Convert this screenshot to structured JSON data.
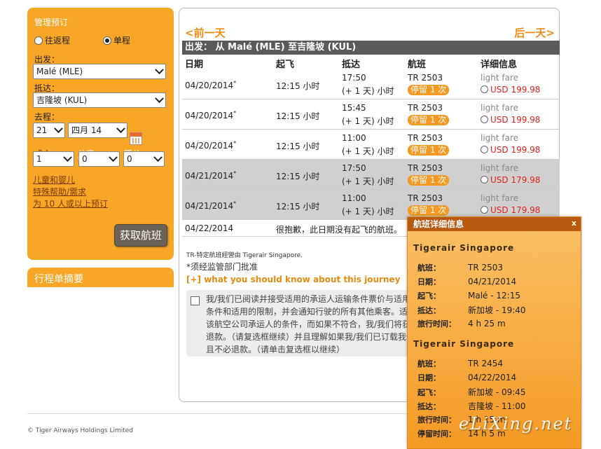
{
  "booking": {
    "title": "管理预订",
    "round_trip_label": "往返程",
    "one_way_label": "单程",
    "origin_label": "出发：",
    "origin_value": "Malé (MLE)",
    "destination_label": "抵达：",
    "destination_value": "吉隆坡 (KUL)",
    "depart_label": "去程：",
    "day_value": "21",
    "month_value": "四月 14",
    "adults_label": "成人",
    "children_label": "儿童",
    "infants_label": "婴儿",
    "adults_value": "1",
    "children_value": "0",
    "infants_value": "0",
    "links": [
      "儿童和婴儿",
      "特殊帮助/需求",
      "为 10 人或以上预订"
    ],
    "search_button": "获取航班"
  },
  "itinerary": {
    "title": "行程单摘要"
  },
  "results": {
    "prev_day": "<前一天",
    "next_day": "后一天>",
    "route": "出发： 从     Malé (MLE) 至吉隆坡 (KUL)",
    "headers": {
      "date": "日期",
      "depart": "起飞",
      "arrive": "抵达",
      "flight": "航班",
      "details": "详细信息"
    },
    "rows": [
      {
        "date": "04/20/2014",
        "mark": "*",
        "depart": "12:15 小时",
        "arrive": "17:50",
        "arrive2": "(+ 1 天) 小时",
        "flight": "TR 2503",
        "stops": "停留 1 次",
        "fare": "light fare",
        "price": "USD 199.98"
      },
      {
        "date": "04/20/2014",
        "mark": "*",
        "depart": "12:15 小时",
        "arrive": "15:45",
        "arrive2": "(+ 1 天) 小时",
        "flight": "TR 2503",
        "stops": "停留 1 次",
        "fare": "light fare",
        "price": "USD 199.98"
      },
      {
        "date": "04/20/2014",
        "mark": "*",
        "depart": "12:15 小时",
        "arrive": "11:00",
        "arrive2": "(+ 1 天) 小时",
        "flight": "TR 2503",
        "stops": "停留 1 次",
        "fare": "light fare",
        "price": "USD 199.98"
      },
      {
        "date": "04/21/2014",
        "mark": "*",
        "depart": "12:15 小时",
        "arrive": "17:50",
        "arrive2": "(+ 1 天) 小时",
        "flight": "TR 2503",
        "stops": "停留 1 次",
        "fare": "light fare",
        "price": "USD 179.98"
      },
      {
        "date": "04/21/2014",
        "mark": "*",
        "depart": "12:15 小时",
        "arrive": "11:00",
        "arrive2": "(+ 1 天) 小时",
        "flight": "TR 2503",
        "stops": "停留 1 次",
        "fare": "light fare",
        "price": "USD 179.98"
      }
    ],
    "no_flight_date": "04/22/2014",
    "no_flight_msg": "很抱歉，此日期没有起飞的航班。",
    "note_tr": "TR-特定航班經營由 Tigerair Singapore.",
    "note_approval": "*须经监管部门批准",
    "know_link": "[+] what you should know about this journey",
    "terms_text": "我/我们已阅读并接受适用的承运人运输条件票价与适用的条件和适用的限制，并会通知行驶的所有其他乘客。适用该航空公司承运人的条件，而如果不符合，我/我们将获得退款。（请复选框继续）并且理解如果我/我们已订载我们且不必退款。（请单击复选框以继续）"
  },
  "popup": {
    "title": "航班详细信息",
    "close": "x",
    "segments": [
      {
        "airline": "Tigerair Singapore",
        "flight_label": "航班：",
        "flight": "TR  2503",
        "date_label": "日期：",
        "date": "04/21/2014",
        "dep_label": "起飞：",
        "dep": "Malé - 12:15",
        "arr_label": "抵达：",
        "arr": "新加坡 - 19:40",
        "time_label": "旅行时间：",
        "time": "4 h 25 m"
      },
      {
        "airline": "Tigerair Singapore",
        "flight_label": "航班：",
        "flight": "TR  2454",
        "date_label": "日期：",
        "date": "04/22/2014",
        "dep_label": "起飞：",
        "dep": "新加坡 - 09:45",
        "arr_label": "抵达：",
        "arr": "吉隆坡 - 11:00",
        "time_label": "旅行时间：",
        "time": "1 h 15 m"
      }
    ],
    "stop_label": "停留时间：",
    "stop_time": "14 h 5 m"
  },
  "footer": {
    "copyright": "© Tiger Airways Holdings Limited"
  },
  "watermark": "eLiXing.net"
}
